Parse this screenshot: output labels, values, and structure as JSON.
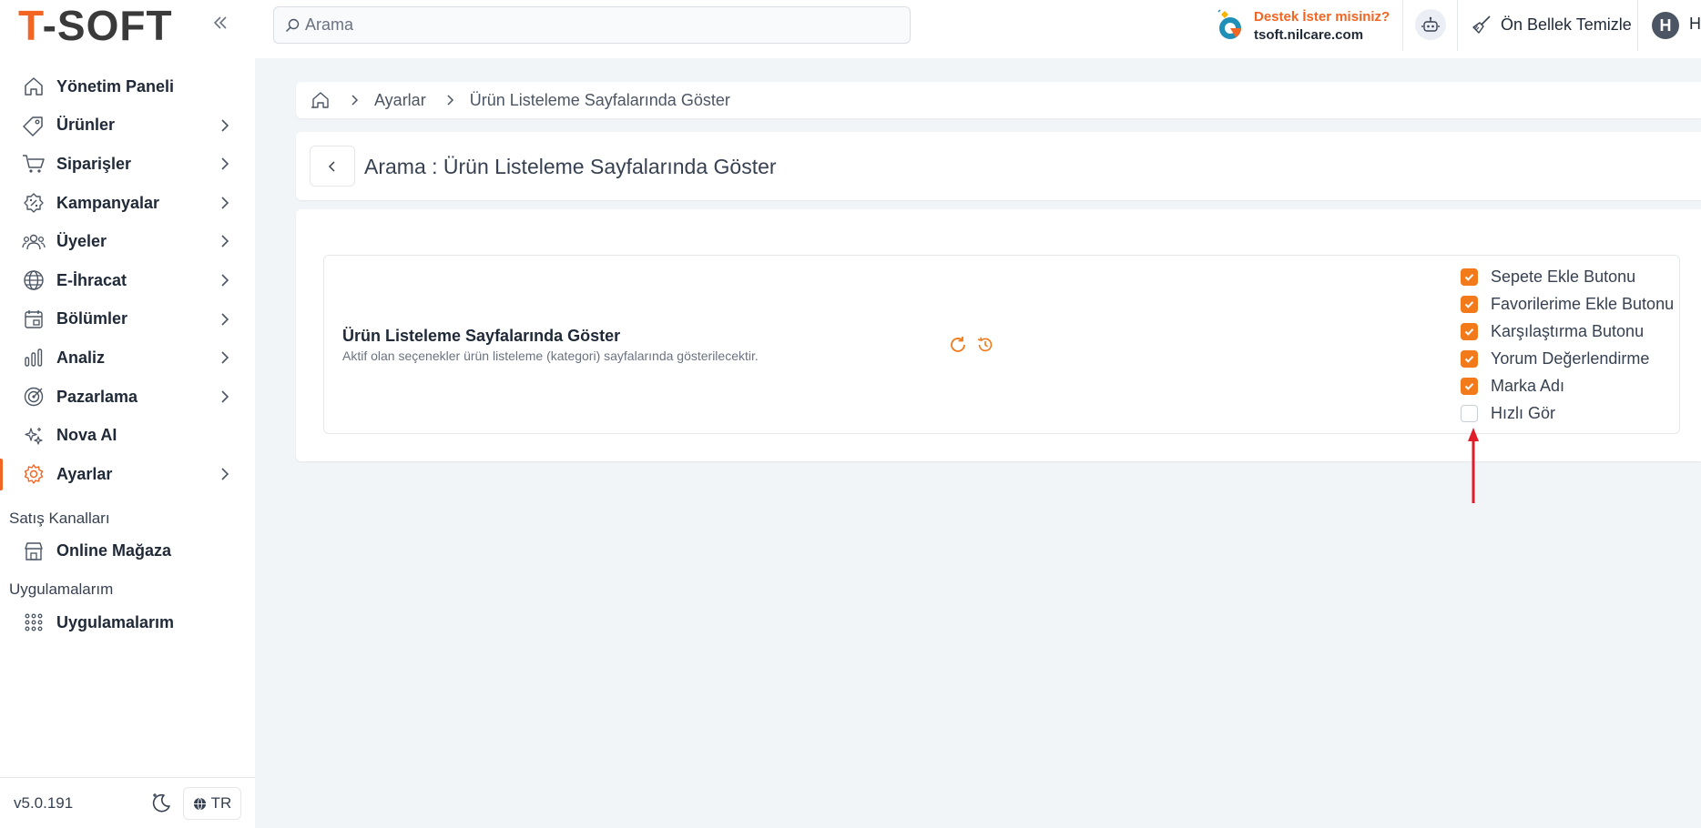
{
  "brand": {
    "logo_t": "T",
    "logo_rest": "-SOFT",
    "accent": "#f26522"
  },
  "header": {
    "search_placeholder": "Arama",
    "support_question": "Destek İster misiniz?",
    "support_domain": "tsoft.nilcare.com",
    "cache_label": "Ön Bellek Temizle",
    "avatar_initial": "H",
    "user_initial": "H"
  },
  "sidebar": {
    "items": [
      {
        "label": "Yönetim Paneli",
        "icon": "home-icon",
        "has_children": false,
        "active": false
      },
      {
        "label": "Ürünler",
        "icon": "tag-icon",
        "has_children": true,
        "active": false
      },
      {
        "label": "Siparişler",
        "icon": "cart-icon",
        "has_children": true,
        "active": false
      },
      {
        "label": "Kampanyalar",
        "icon": "discount-icon",
        "has_children": true,
        "active": false
      },
      {
        "label": "Üyeler",
        "icon": "users-icon",
        "has_children": true,
        "active": false
      },
      {
        "label": "E-İhracat",
        "icon": "globe-icon",
        "has_children": true,
        "active": false
      },
      {
        "label": "Bölümler",
        "icon": "layout-icon",
        "has_children": true,
        "active": false
      },
      {
        "label": "Analiz",
        "icon": "chart-icon",
        "has_children": true,
        "active": false
      },
      {
        "label": "Pazarlama",
        "icon": "target-icon",
        "has_children": true,
        "active": false
      },
      {
        "label": "Nova AI",
        "icon": "sparkle-icon",
        "has_children": false,
        "active": false
      },
      {
        "label": "Ayarlar",
        "icon": "gear-icon",
        "has_children": true,
        "active": true
      }
    ],
    "sales_channels_title": "Satış Kanalları",
    "online_store": "Online Mağaza",
    "apps_title": "Uygulamalarım",
    "apps_item": "Uygulamalarım",
    "version": "v5.0.191",
    "lang": "TR"
  },
  "breadcrumb": {
    "items": [
      "Ayarlar",
      "Ürün Listeleme Sayfalarında Göster"
    ]
  },
  "page": {
    "title": "Arama : Ürün Listeleme Sayfalarında Göster",
    "setting_title": "Ürün Listeleme Sayfalarında Göster",
    "setting_desc": "Aktif olan seçenekler ürün listeleme (kategori) sayfalarında gösterilecektir.",
    "options": [
      {
        "label": "Sepete Ekle Butonu",
        "checked": true
      },
      {
        "label": "Favorilerime Ekle Butonu",
        "checked": true
      },
      {
        "label": "Karşılaştırma Butonu",
        "checked": true
      },
      {
        "label": "Yorum Değerlendirme",
        "checked": true
      },
      {
        "label": "Marka Adı",
        "checked": true
      },
      {
        "label": "Hızlı Gör",
        "checked": false
      }
    ]
  },
  "colors": {
    "checkbox_on": "#f27a1a",
    "arrow": "#e11d2a"
  }
}
